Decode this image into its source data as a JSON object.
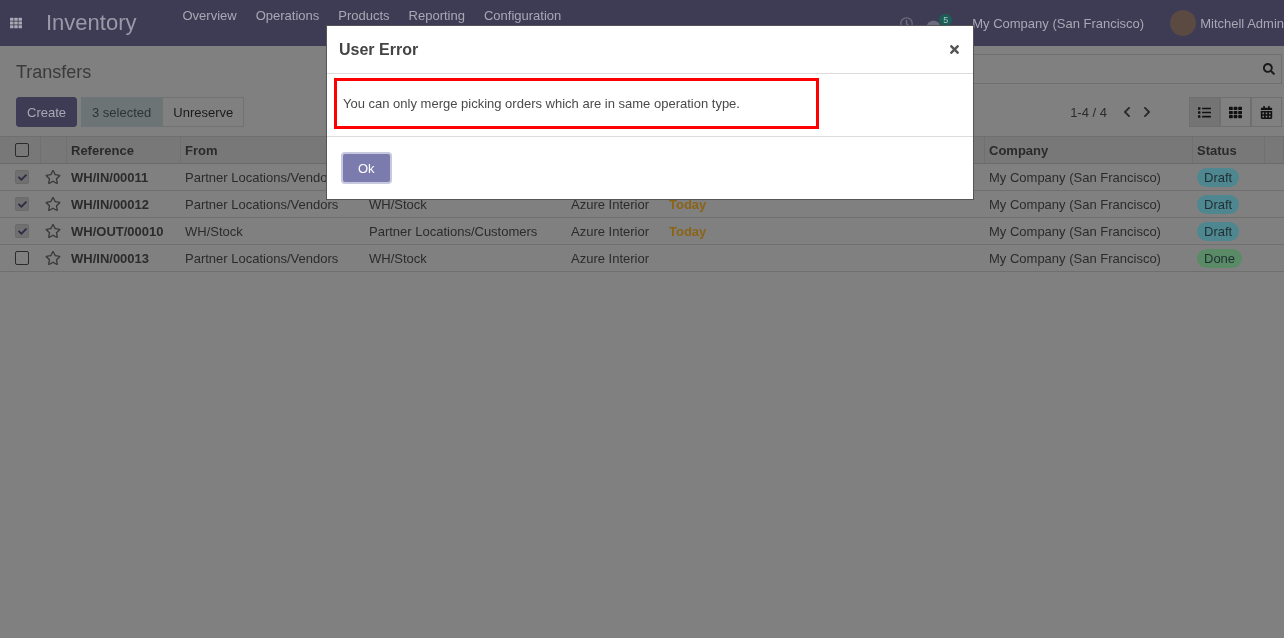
{
  "navbar": {
    "app_title": "Inventory",
    "menu": [
      "Overview",
      "Operations",
      "Products",
      "Reporting",
      "Configuration"
    ],
    "message_count": "5",
    "company": "My Company (San Francisco)",
    "user": "Mitchell Admin"
  },
  "control_panel": {
    "title": "Transfers",
    "create_button": "Create",
    "selection_count": "3 selected",
    "action_button": "Unreserve",
    "pager": "1-4 / 4",
    "views": [
      {
        "kind": "list",
        "selected": true
      },
      {
        "kind": "kanban",
        "selected": false
      },
      {
        "kind": "calendar",
        "selected": false
      }
    ]
  },
  "table": {
    "all_checked": false,
    "headers": {
      "reference": "Reference",
      "from": "From",
      "company": "Company",
      "status": "Status"
    },
    "rows": [
      {
        "selected": true,
        "reference": "WH/IN/00011",
        "from": "Partner Locations/Vendo",
        "company": "My Company (San Francisco)",
        "status": {
          "label": "Draft",
          "color": "#4f8791"
        }
      },
      {
        "selected": true,
        "reference": "WH/IN/00012",
        "from": "Partner Locations/Vendors",
        "to": "WH/Stock",
        "contact": "Azure Interior",
        "date": "Today",
        "company": "My Company (San Francisco)",
        "status": {
          "label": "Draft",
          "color": "#4f8791"
        }
      },
      {
        "selected": true,
        "reference": "WH/OUT/00010",
        "from": "WH/Stock",
        "to": "Partner Locations/Customers",
        "contact": "Azure Interior",
        "date": "Today",
        "company": "My Company (San Francisco)",
        "status": {
          "label": "Draft",
          "color": "#4f8791"
        }
      },
      {
        "selected": false,
        "reference": "WH/IN/00013",
        "from": "Partner Locations/Vendors",
        "to": "WH/Stock",
        "contact": "Azure Interior",
        "company": "My Company (San Francisco)",
        "status": {
          "label": "Done",
          "color": "#5a8a66"
        }
      }
    ]
  },
  "dialog": {
    "title": "User Error",
    "message": "You can only merge picking orders which are in same operation type.",
    "ok_button": "Ok"
  }
}
